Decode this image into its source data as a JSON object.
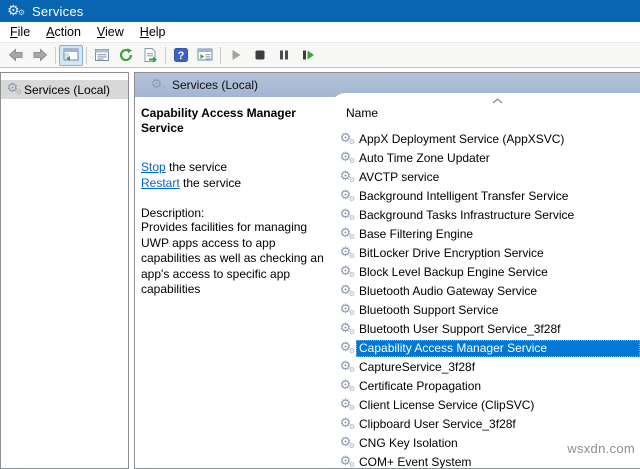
{
  "window": {
    "title": "Services"
  },
  "menu_bar": {
    "items": [
      "File",
      "Action",
      "View",
      "Help"
    ]
  },
  "toolbar": {
    "buttons": [
      {
        "name": "back",
        "icon": "back-arrow-icon",
        "enabled": false
      },
      {
        "name": "forward",
        "icon": "forward-arrow-icon",
        "enabled": false
      },
      {
        "name": "show-hide-console-tree",
        "icon": "console-tree-icon",
        "active": true
      },
      {
        "name": "properties",
        "icon": "properties-window-icon",
        "enabled": true
      },
      {
        "name": "refresh",
        "icon": "refresh-icon",
        "enabled": true
      },
      {
        "name": "export-list",
        "icon": "export-list-icon",
        "enabled": true
      },
      {
        "name": "help",
        "icon": "help-icon",
        "enabled": true
      },
      {
        "name": "show-hide-action-pane",
        "icon": "action-pane-icon",
        "enabled": true
      },
      {
        "name": "start-service",
        "icon": "play-icon",
        "enabled": false
      },
      {
        "name": "stop-service",
        "icon": "stop-icon",
        "enabled": true
      },
      {
        "name": "pause-service",
        "icon": "pause-icon",
        "enabled": true
      },
      {
        "name": "restart-service",
        "icon": "restart-icon",
        "enabled": true
      }
    ]
  },
  "left_pane": {
    "root_label": "Services (Local)"
  },
  "extended_view": {
    "header": "Services (Local)",
    "service_title": "Capability Access Manager Service",
    "stop_link": "Stop",
    "stop_suffix": " the service",
    "restart_link": "Restart",
    "restart_suffix": " the service",
    "description_label": "Description:",
    "description": "Provides facilities for managing UWP apps access to app capabilities as well as checking an app's access to specific app capabilities"
  },
  "services_list": {
    "column_header": "Name",
    "sort": "ascending",
    "selected_index": 11,
    "items": [
      "AppX Deployment Service (AppXSVC)",
      "Auto Time Zone Updater",
      "AVCTP service",
      "Background Intelligent Transfer Service",
      "Background Tasks Infrastructure Service",
      "Base Filtering Engine",
      "BitLocker Drive Encryption Service",
      "Block Level Backup Engine Service",
      "Bluetooth Audio Gateway Service",
      "Bluetooth Support Service",
      "Bluetooth User Support Service_3f28f",
      "Capability Access Manager Service",
      "CaptureService_3f28f",
      "Certificate Propagation",
      "Client License Service (ClipSVC)",
      "Clipboard User Service_3f28f",
      "CNG Key Isolation",
      "COM+ Event System"
    ]
  },
  "watermark": {
    "text": "wsxdn.com"
  },
  "colors": {
    "titlebar_blue": "#0865B2",
    "selection_blue": "#0078D7",
    "pane_header_blue": "#A9BBD5",
    "link_blue": "#0066CC",
    "toolbar_green": "#3BA53B"
  }
}
